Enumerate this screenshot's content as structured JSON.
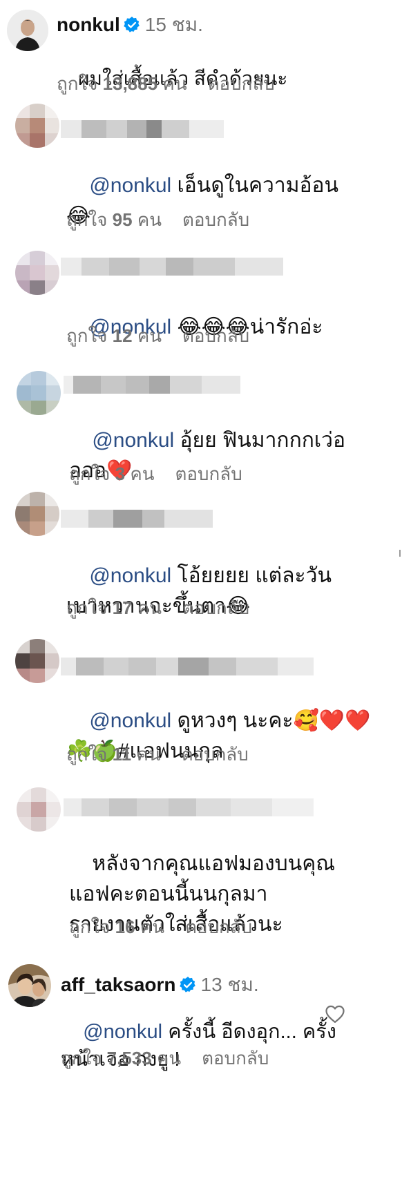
{
  "comments": [
    {
      "username": "nonkul",
      "verified": true,
      "time": "15 ชม.",
      "mention": "",
      "text": "ผมใส่เสื้อแล้ว สีดำด้วยนะ",
      "likes_label": "ถูกใจ",
      "likes_count": "13,885",
      "likes_unit": "คน",
      "reply_label": "ตอบกลับ"
    },
    {
      "username": "",
      "mention": "@nonkul",
      "text": " เอ็นดูในความอ้อน\n😂",
      "likes_label": "ถูกใจ",
      "likes_count": "95",
      "likes_unit": "คน",
      "reply_label": "ตอบกลับ"
    },
    {
      "username": "",
      "mention": "@nonkul",
      "text": " 😂😂😂น่ารักอ่ะ",
      "likes_label": "ถูกใจ",
      "likes_count": "12",
      "likes_unit": "คน",
      "reply_label": "ตอบกลับ"
    },
    {
      "username": "",
      "mention": "@nonkul",
      "text": " อุ้ยย ฟินมากกกเว่อ\nอออ❤️",
      "likes_label": "ถูกใจ",
      "likes_count": "3",
      "likes_unit": "คน",
      "reply_label": "ตอบกลับ"
    },
    {
      "username": "",
      "mention": "@nonkul",
      "text": " โอ้ยยยย แต่ละวัน\nเบาหวานจะขึ้นตา😂",
      "likes_label": "ถูกใจ",
      "likes_count": "17",
      "likes_unit": "คน",
      "reply_label": "ตอบกลับ"
    },
    {
      "username": "",
      "mention": "@nonkul",
      "text": " ดูหวงๆ นะคะ🥰❤️❤️\n☘️🍏#แอฟนนกุล",
      "likes_label": "ถูกใจ",
      "likes_count": "11",
      "likes_unit": "คน",
      "reply_label": "ตอบกลับ"
    },
    {
      "username": "",
      "mention": "",
      "text": "หลังจากคุณแอฟมองบนคุณ\nแอฟคะตอนนี้นนกุลมา\nรายงานตัวใส่เสื้อแล้วนะ",
      "likes_label": "ถูกใจ",
      "likes_count": "16",
      "likes_unit": "คน",
      "reply_label": "ตอบกลับ"
    },
    {
      "username": "aff_taksaorn",
      "verified": true,
      "time": "13 ชม.",
      "mention": "@nonkul",
      "text": " ครั้งนี้ อีดงอุก... ครั้ง\nหน้าเจอ กงยู !",
      "likes_label": "ถูกใจ",
      "likes_count": "7,533",
      "likes_unit": "คน",
      "reply_label": "ตอบกลับ"
    }
  ],
  "icons": {
    "verified": "verified-badge-icon",
    "like": "heart-outline-icon"
  },
  "colors": {
    "verified_blue": "#0095f6",
    "mention": "#2b4d84",
    "secondary_text": "#737373"
  }
}
